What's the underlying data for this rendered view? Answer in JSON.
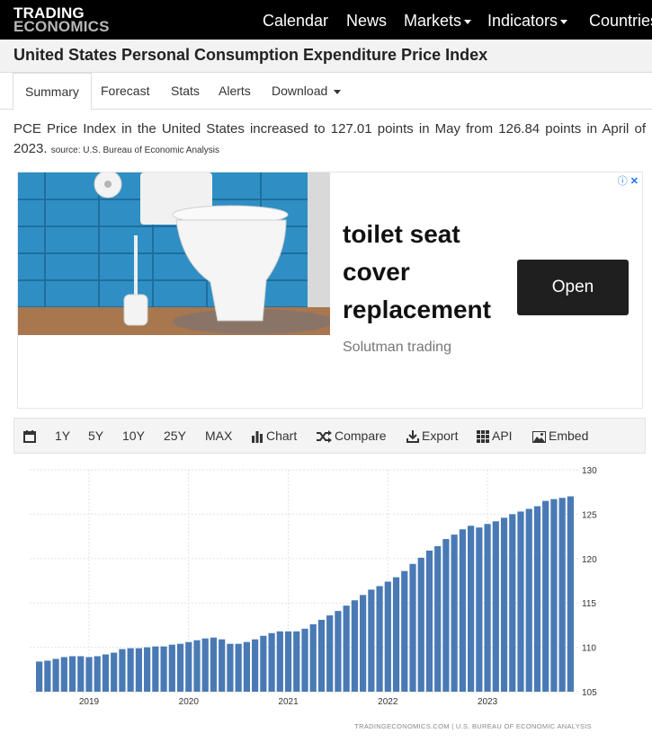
{
  "header": {
    "logo_line1": "TRADING",
    "logo_line2": "ECONOMICS",
    "nav": [
      "Calendar",
      "News",
      "Markets",
      "Indicators",
      "Countries"
    ]
  },
  "page_title": "United States Personal Consumption Expenditure Price Index",
  "tabs": [
    "Summary",
    "Forecast",
    "Stats",
    "Alerts",
    "Download"
  ],
  "description": {
    "text": "PCE Price Index in the United States increased to 127.01 points in May from 126.84 points in April of 2023.",
    "source": "source: U.S. Bureau of Economic Analysis"
  },
  "ad": {
    "headline_lines": [
      "toilet seat",
      "cover",
      "replacement"
    ],
    "brand": "Solutman trading",
    "button": "Open"
  },
  "toolbar": {
    "ranges": [
      "1Y",
      "5Y",
      "10Y",
      "25Y",
      "MAX"
    ],
    "chart": "Chart",
    "compare": "Compare",
    "export": "Export",
    "api": "API",
    "embed": "Embed"
  },
  "chart_data": {
    "type": "bar",
    "title": "",
    "xlabel": "",
    "ylabel": "",
    "ylim": [
      105,
      130
    ],
    "yticks": [
      105,
      110,
      115,
      120,
      125,
      130
    ],
    "year_ticks": [
      {
        "label": "2019",
        "index": 6
      },
      {
        "label": "2020",
        "index": 18
      },
      {
        "label": "2021",
        "index": 30
      },
      {
        "label": "2022",
        "index": 42
      },
      {
        "label": "2023",
        "index": 54
      }
    ],
    "first_period": "2018-06",
    "last_period": "2023-05",
    "values": [
      108.4,
      108.5,
      108.7,
      108.9,
      109.0,
      109.0,
      108.9,
      109.0,
      109.2,
      109.4,
      109.8,
      109.9,
      109.9,
      110.0,
      110.1,
      110.1,
      110.3,
      110.4,
      110.6,
      110.8,
      111.0,
      111.1,
      110.9,
      110.4,
      110.4,
      110.6,
      110.9,
      111.3,
      111.6,
      111.8,
      111.8,
      111.8,
      112.1,
      112.6,
      113.1,
      113.6,
      114.1,
      114.7,
      115.3,
      115.9,
      116.5,
      116.9,
      117.4,
      117.9,
      118.6,
      119.4,
      120.1,
      120.9,
      121.4,
      122.2,
      122.7,
      123.3,
      123.7,
      123.5,
      123.9,
      124.2,
      124.6,
      125.0,
      125.3,
      125.6,
      125.9,
      126.5,
      126.7,
      126.84,
      127.01
    ],
    "footer": "TRADINGECONOMICS.COM  |  U.S. BUREAU OF ECONOMIC ANALYSIS"
  },
  "colors": {
    "bar": "#4a7ab5",
    "topbar": "#000000",
    "button": "#1f1f1f"
  }
}
